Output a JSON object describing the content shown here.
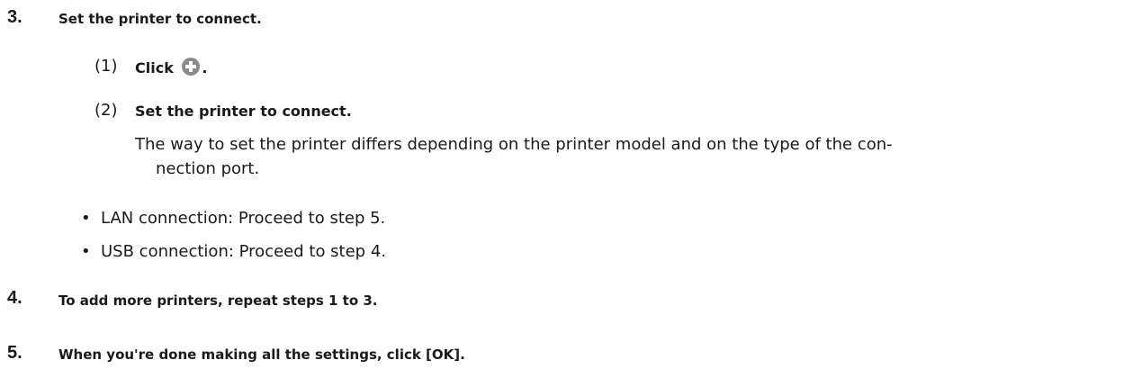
{
  "steps": [
    {
      "number": "3.",
      "heading": "Set the printer to connect.",
      "substeps": [
        {
          "number": "(1)",
          "prefix": "Click",
          "icon": "add-circle-icon",
          "suffix": "."
        },
        {
          "number": "(2)",
          "text": "Set the printer to connect."
        }
      ],
      "description_lines": [
        "The way to set the printer differs depending on the printer model and on the type of the con-",
        "nection port."
      ],
      "bullets": [
        "LAN connection: Proceed to step 5.",
        "USB connection: Proceed to step 4."
      ]
    },
    {
      "number": "4.",
      "heading": "To add more printers, repeat steps 1 to 3."
    },
    {
      "number": "5.",
      "heading": "When you're done making all the settings, click [OK]."
    }
  ],
  "colors": {
    "text": "#1a1a1a",
    "icon_fill": "#8a8a8a"
  }
}
